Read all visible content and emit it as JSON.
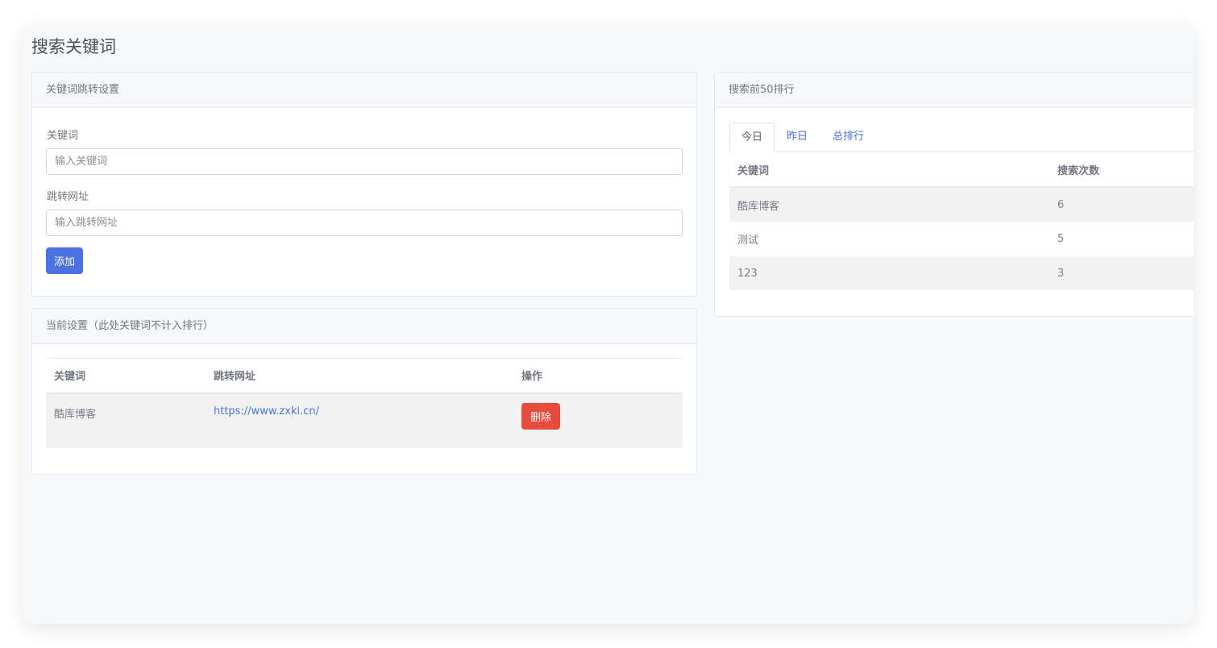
{
  "page": {
    "title": "搜索关键词"
  },
  "redirect_form": {
    "header": "关键词跳转设置",
    "keyword_label": "关键词",
    "keyword_placeholder": "输入关键词",
    "keyword_value": "",
    "url_label": "跳转网址",
    "url_placeholder": "输入跳转网址",
    "url_value": "",
    "add_label": "添加"
  },
  "current_settings": {
    "header": "当前设置（此处关键词不计入排行）",
    "columns": [
      "关键词",
      "跳转网址",
      "操作"
    ],
    "rows": [
      {
        "keyword": "酷库博客",
        "url": "https://www.zxki.cn/",
        "action": "删除"
      }
    ]
  },
  "ranking": {
    "header": "搜索前50排行",
    "tabs": [
      {
        "label": "今日",
        "active": true
      },
      {
        "label": "昨日",
        "active": false
      },
      {
        "label": "总排行",
        "active": false
      }
    ],
    "columns": [
      "关键词",
      "搜索次数"
    ],
    "rows": [
      {
        "keyword": "酷库博客",
        "count": "6"
      },
      {
        "keyword": "测试",
        "count": "5"
      },
      {
        "keyword": "123",
        "count": "3"
      }
    ]
  },
  "colors": {
    "primary": "#4a73df",
    "danger": "#e74b3c",
    "stripe": "#f2f2f2",
    "background": "#f7f8fb"
  }
}
